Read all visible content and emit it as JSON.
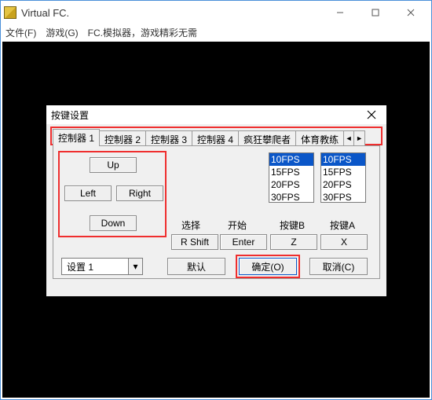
{
  "window": {
    "title": "Virtual FC.",
    "menus": [
      "文件(F)",
      "游戏(G)",
      "FC.模拟器，游戏精彩无需"
    ]
  },
  "dialog": {
    "title": "按键设置",
    "tabs": [
      "控制器 1",
      "控制器 2",
      "控制器 3",
      "控制器 4",
      "疯狂攀爬者",
      "体育教练"
    ],
    "dpad": {
      "up": "Up",
      "left": "Left",
      "right": "Right",
      "down": "Down"
    },
    "fps": {
      "optionsA": [
        "10FPS",
        "15FPS",
        "20FPS",
        "30FPS"
      ],
      "optionsB": [
        "10FPS",
        "15FPS",
        "20FPS",
        "30FPS"
      ]
    },
    "labels": {
      "select": "选择",
      "start": "开始",
      "btnB": "按键B",
      "btnA": "按键A"
    },
    "keys": {
      "select": "R Shift",
      "start": "Enter",
      "btnB": "Z",
      "btnA": "X"
    },
    "profile": "设置 1",
    "buttons": {
      "default": "默认",
      "ok": "确定(O)",
      "cancel": "取消(C)"
    }
  }
}
